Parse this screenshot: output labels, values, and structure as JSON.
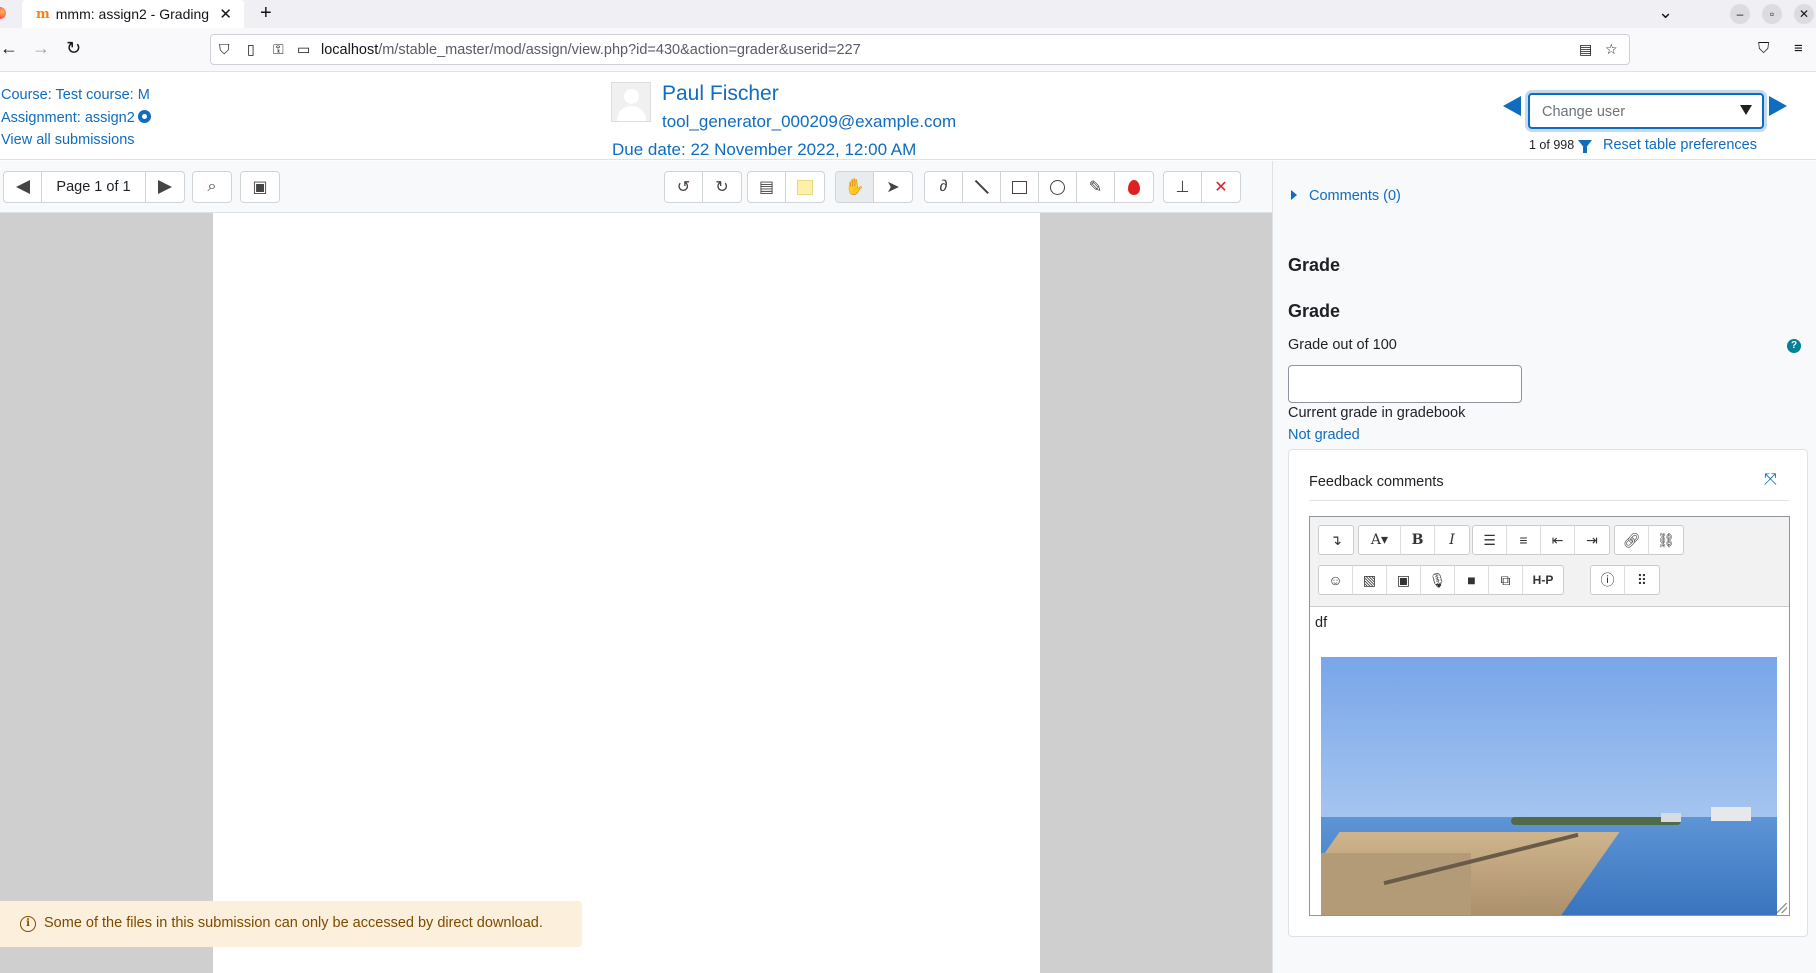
{
  "browser": {
    "tab_title": "mmm: assign2 - Grading",
    "tab_close": "✕",
    "new_tab": "+",
    "url_host": "localhost",
    "url_path": "/m/stable_master/mod/assign/view.php?id=430&action=grader&userid=227"
  },
  "header": {
    "course_link": "Course: Test course: M",
    "assignment_link": "Assignment: assign2",
    "view_all": "View all submissions",
    "user_name": "Paul Fischer",
    "user_email": "tool_generator_000209@example.com",
    "due_date": "Due date: 22 November 2022, 12:00 AM",
    "change_user_placeholder": "Change user",
    "count": "1 of 998",
    "reset_prefs": "Reset table preferences"
  },
  "pdf": {
    "page_label": "Page 1 of 1",
    "notice": "Some of the files in this submission can only be accessed by direct download."
  },
  "panel": {
    "comments_link": "Comments (0)",
    "grade_heading_1": "Grade",
    "grade_heading_2": "Grade",
    "grade_out_of": "Grade out of 100",
    "grade_value": "",
    "current_grade_label": "Current grade in gradebook",
    "not_graded": "Not graded",
    "feedback_title": "Feedback comments",
    "editor_text": "df"
  },
  "colors": {
    "link": "#0f6cbf",
    "notice_bg": "#fcefdc",
    "help": "#008196"
  }
}
